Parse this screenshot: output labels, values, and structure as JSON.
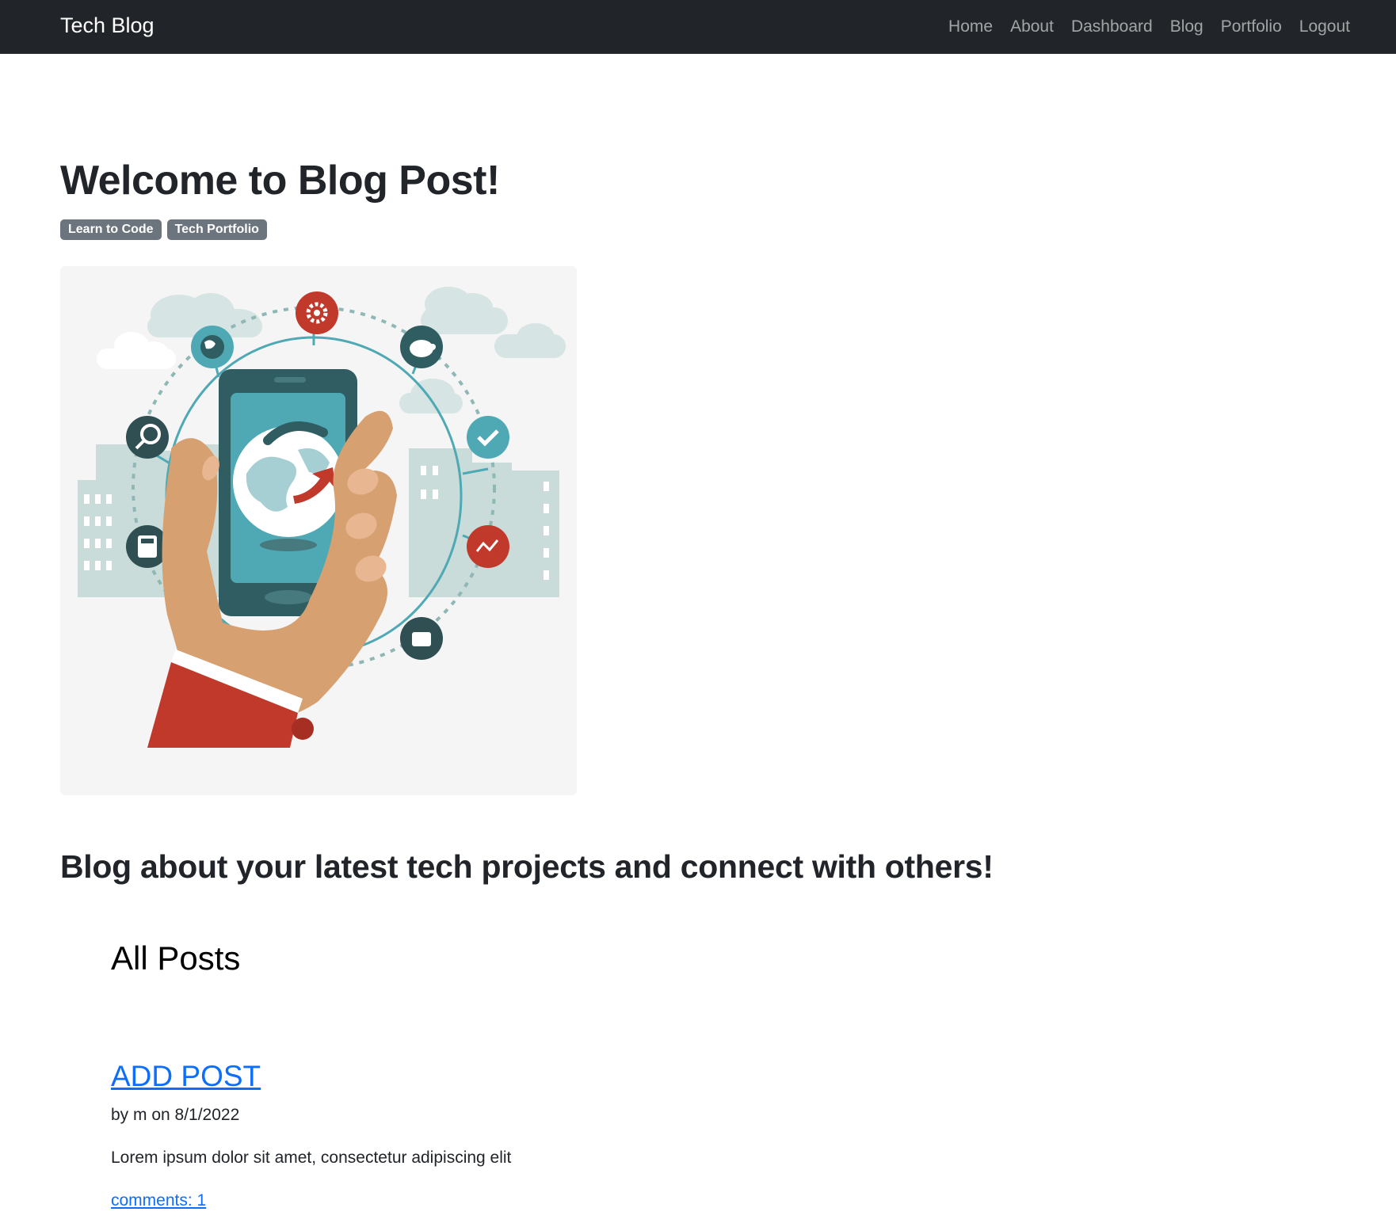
{
  "navbar": {
    "brand": "Tech Blog",
    "links": [
      {
        "label": "Home"
      },
      {
        "label": "About"
      },
      {
        "label": "Dashboard"
      },
      {
        "label": "Blog"
      },
      {
        "label": "Portfolio"
      },
      {
        "label": "Logout"
      }
    ]
  },
  "hero": {
    "title": "Welcome to Blog Post!",
    "badges": [
      "Learn to Code",
      "Tech Portfolio"
    ],
    "image_icon": "hand-holding-phone-illustration",
    "tagline": "Blog about your latest tech projects and connect with others!"
  },
  "posts": {
    "heading": "All Posts",
    "items": [
      {
        "title": "ADD POST",
        "meta": "by m on 8/1/2022",
        "body": "Lorem ipsum dolor sit amet, consectetur adipiscing elit",
        "comments": "comments: 1"
      }
    ]
  },
  "colors": {
    "navbar_bg": "#212529",
    "badge_bg": "#6c757d",
    "link": "#0d6efd",
    "accent_red": "#c0392b",
    "accent_teal": "#4fa9b5"
  }
}
